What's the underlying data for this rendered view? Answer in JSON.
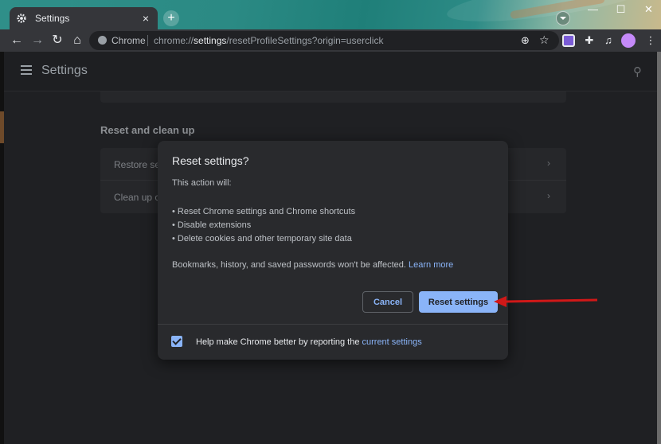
{
  "browser": {
    "tab": {
      "title": "Settings",
      "icon": "gear-icon"
    },
    "omnibox": {
      "site_label": "Chrome",
      "url_prefix": "chrome://",
      "url_highlight": "settings",
      "url_suffix": "/resetProfileSettings?origin=userclick"
    },
    "window_buttons": {
      "minimize": "—",
      "maximize": "☐",
      "close": "✕"
    }
  },
  "settings_page": {
    "title": "Settings",
    "section_title": "Reset and clean up",
    "rows": [
      {
        "label": "Restore settings to their original defaults"
      },
      {
        "label": "Clean up computer"
      }
    ]
  },
  "dialog": {
    "title": "Reset settings?",
    "intro": "This action will:",
    "items": [
      "Reset Chrome settings and Chrome shortcuts",
      "Disable extensions",
      "Delete cookies and other temporary site data"
    ],
    "note": "Bookmarks, history, and saved passwords won't be affected.",
    "learn_more": "Learn more",
    "cancel_label": "Cancel",
    "reset_label": "Reset settings",
    "footer_text": "Help make Chrome better by reporting the",
    "footer_link": "current settings",
    "checkbox_checked": true
  },
  "colors": {
    "accent": "#8ab4f8",
    "dialog_bg": "#292a2d",
    "arrow": "#d01818"
  }
}
